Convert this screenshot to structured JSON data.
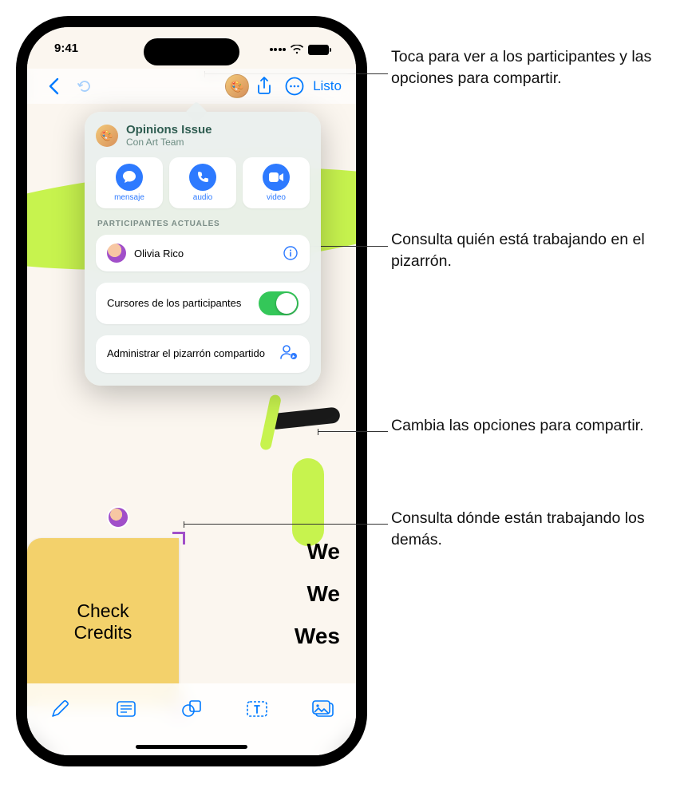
{
  "status": {
    "time": "9:41"
  },
  "toolbar": {
    "done": "Listo"
  },
  "popover": {
    "title": "Opinions Issue",
    "subtitle": "Con Art Team",
    "actions": {
      "message": "mensaje",
      "audio": "audio",
      "video": "video"
    },
    "section_current": "PARTICIPANTES ACTUALES",
    "participant_name": "Olivia Rico",
    "cursors_label": "Cursores de los participantes",
    "manage_label": "Administrar el pizarrón compartido"
  },
  "canvas": {
    "sticky_text": "Check\nCredits",
    "line1": "We",
    "line2": "We",
    "line3": "Wes"
  },
  "callouts": {
    "c1": "Toca para ver a los participantes y las opciones para compartir.",
    "c2": "Consulta quién está trabajando en el pizarrón.",
    "c3": "Cambia las opciones para compartir.",
    "c4": "Consulta dónde están trabajando los demás."
  }
}
